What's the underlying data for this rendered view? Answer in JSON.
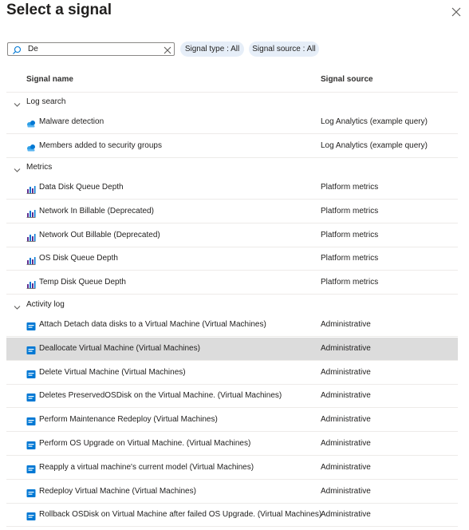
{
  "panel": {
    "title": "Select a signal"
  },
  "search": {
    "value": "De"
  },
  "filters": [
    {
      "label": "Signal type : All"
    },
    {
      "label": "Signal source : All"
    }
  ],
  "columns": {
    "name": "Signal name",
    "source": "Signal source"
  },
  "groups": [
    {
      "label": "Log search",
      "icon": "log-analytics-icon",
      "rows": [
        {
          "name": "Malware detection",
          "source": "Log Analytics (example query)"
        },
        {
          "name": "Members added to security groups",
          "source": "Log Analytics (example query)"
        }
      ]
    },
    {
      "label": "Metrics",
      "icon": "metric-chart-icon",
      "rows": [
        {
          "name": "Data Disk Queue Depth",
          "source": "Platform metrics"
        },
        {
          "name": "Network In Billable (Deprecated)",
          "source": "Platform metrics"
        },
        {
          "name": "Network Out Billable (Deprecated)",
          "source": "Platform metrics"
        },
        {
          "name": "OS Disk Queue Depth",
          "source": "Platform metrics"
        },
        {
          "name": "Temp Disk Queue Depth",
          "source": "Platform metrics"
        }
      ]
    },
    {
      "label": "Activity log",
      "icon": "activity-log-icon",
      "rows": [
        {
          "name": "Attach Detach data disks to a Virtual Machine (Virtual Machines)",
          "source": "Administrative"
        },
        {
          "name": "Deallocate Virtual Machine (Virtual Machines)",
          "source": "Administrative",
          "selected": true
        },
        {
          "name": "Delete Virtual Machine (Virtual Machines)",
          "source": "Administrative"
        },
        {
          "name": "Deletes PreservedOSDisk on the Virtual Machine. (Virtual Machines)",
          "source": "Administrative"
        },
        {
          "name": "Perform Maintenance Redeploy (Virtual Machines)",
          "source": "Administrative"
        },
        {
          "name": "Perform OS Upgrade on Virtual Machine. (Virtual Machines)",
          "source": "Administrative"
        },
        {
          "name": "Reapply a virtual machine's current model (Virtual Machines)",
          "source": "Administrative"
        },
        {
          "name": "Redeploy Virtual Machine (Virtual Machines)",
          "source": "Administrative"
        },
        {
          "name": "Rollback OSDisk on Virtual Machine after failed OS Upgrade. (Virtual Machines)",
          "source": "Administrative"
        }
      ]
    }
  ],
  "colors": {
    "accent": "#0078d4",
    "pill_bg": "#e6eef8",
    "selected_row": "#dcdcdc"
  }
}
